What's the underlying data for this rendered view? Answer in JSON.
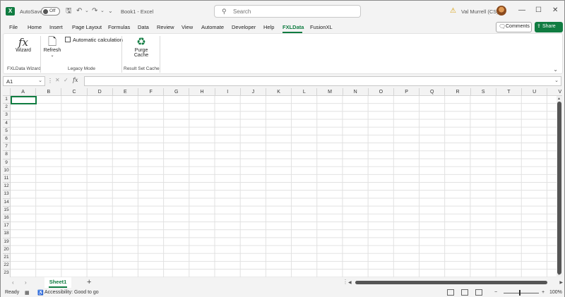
{
  "titlebar": {
    "app_icon": "X",
    "autosave_label": "AutoSave",
    "autosave_state": "Off",
    "workbook_title": "Book1 - Excel",
    "search_placeholder": "Search",
    "user_name": "Val Murrell (CS)",
    "window_minimize": "—",
    "window_restore": "☐",
    "window_close": "✕"
  },
  "menu": {
    "items": [
      "File",
      "Home",
      "Insert",
      "Page Layout",
      "Formulas",
      "Data",
      "Review",
      "View",
      "Automate",
      "Developer",
      "Help",
      "FXLData",
      "FusionXL"
    ],
    "active": "FXLData",
    "comments_label": "Comments",
    "share_label": "Share"
  },
  "ribbon": {
    "wizard_label": "Wizard",
    "refresh_label": "Refresh",
    "refresh_caret": "⌄",
    "auto_calc_label": "Automatic calculation",
    "purge_label_1": "Purge",
    "purge_label_2": "Cache",
    "groups": [
      "FXLData Wizard",
      "Legacy Mode",
      "Result Set Cache"
    ]
  },
  "formula_bar": {
    "name_box": "A1",
    "fx": "fx",
    "value": ""
  },
  "grid": {
    "columns": [
      "A",
      "B",
      "C",
      "D",
      "E",
      "F",
      "G",
      "H",
      "I",
      "J",
      "K",
      "L",
      "M",
      "N",
      "O",
      "P",
      "Q",
      "R",
      "S",
      "T",
      "U",
      "V"
    ],
    "rows": [
      "1",
      "2",
      "3",
      "4",
      "5",
      "6",
      "7",
      "8",
      "9",
      "10",
      "11",
      "12",
      "13",
      "14",
      "15",
      "16",
      "17",
      "18",
      "19",
      "20",
      "21",
      "22",
      "23"
    ]
  },
  "sheets": {
    "tabs": [
      "Sheet1"
    ],
    "add": "+"
  },
  "status": {
    "ready": "Ready",
    "accessibility": "Accessibility: Good to go",
    "zoom": "100%",
    "zoom_minus": "−",
    "zoom_plus": "+"
  },
  "colors": {
    "accent": "#107c41",
    "warning": "#d79b00"
  }
}
